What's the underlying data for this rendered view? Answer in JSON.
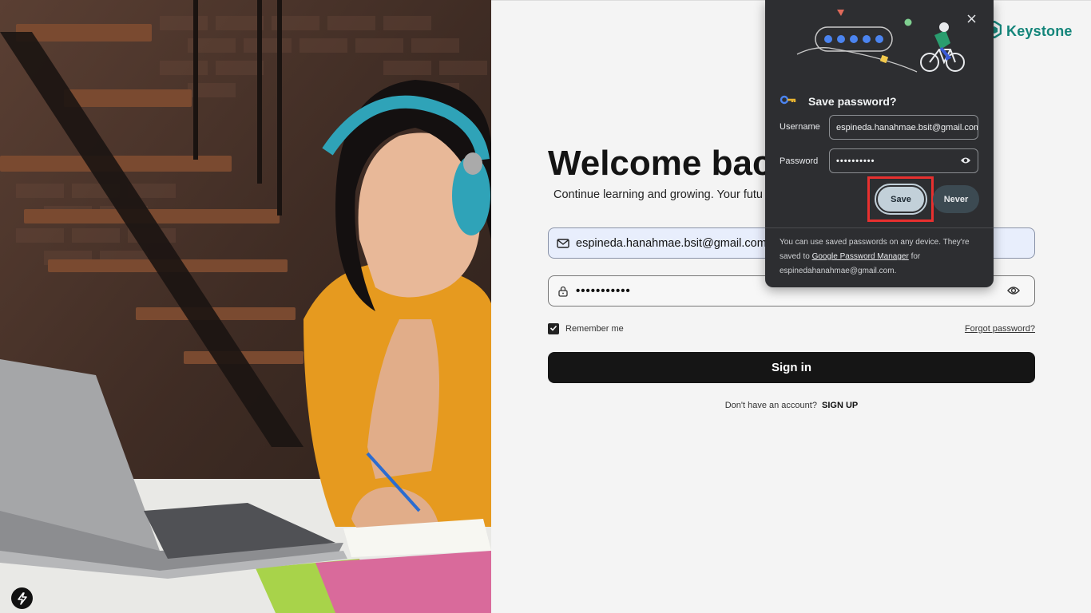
{
  "brand": {
    "name": "Keystone"
  },
  "login": {
    "heading": "Welcome bac",
    "subtitle": "Continue learning and growing. Your futu",
    "email_value": "espineda.hanahmae.bsit@gmail.com",
    "password_value": "•••••••••••",
    "remember_label": "Remember me",
    "remember_checked": true,
    "forgot_label": "Forgot password?",
    "signin_label": "Sign in",
    "signup_prompt": "Don't have an account?",
    "signup_label": "SIGN UP"
  },
  "popup": {
    "title": "Save password?",
    "username_label": "Username",
    "username_value": "espineda.hanahmae.bsit@gmail.com",
    "password_label": "Password",
    "password_value": "••••••••••",
    "save_label": "Save",
    "never_label": "Never",
    "footer_pre": "You can use saved passwords on any device. They're saved to",
    "footer_link": "Google Password Manager",
    "footer_post": "for espinedahanahmae@gmail.com."
  },
  "colors": {
    "brand": "#14857a",
    "popup_bg": "#2d2e31",
    "save_button": "#c2d0d9",
    "highlight": "#e8302f",
    "signin_button": "#151515"
  },
  "icons": {
    "mail": "mail-icon",
    "lock": "lock-icon",
    "eye": "eye-icon",
    "close": "close-icon",
    "key": "key-icon",
    "check": "check-icon",
    "bolt": "bolt-icon",
    "logo": "keystone-logo-icon"
  }
}
